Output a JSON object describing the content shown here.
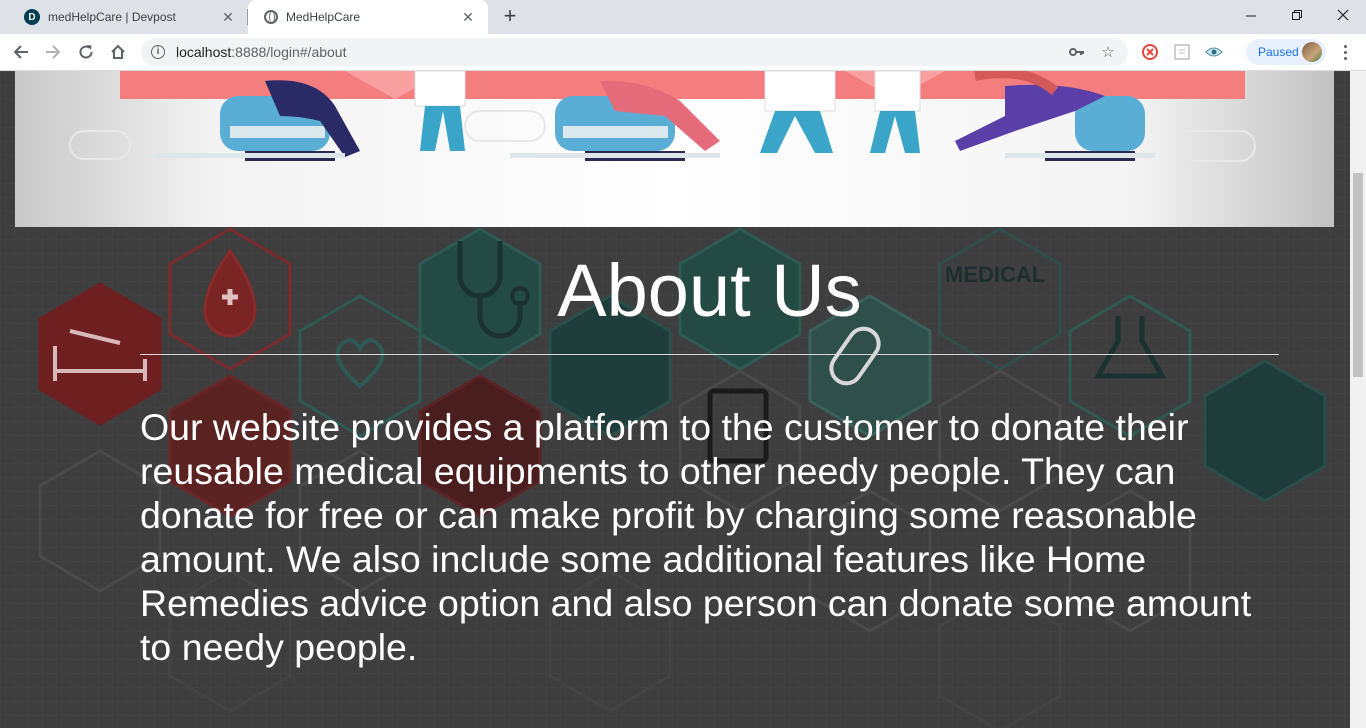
{
  "browser": {
    "tabs": [
      {
        "title": "medHelpCare | Devpost",
        "favicon": "devpost-d-icon",
        "active": false
      },
      {
        "title": "MedHelpCare",
        "favicon": "globe-icon",
        "active": true
      }
    ],
    "url_host": "localhost",
    "url_rest": ":8888/login#/about",
    "profile_label": "Paused"
  },
  "page": {
    "background_icons": [
      "MEDICAL"
    ],
    "title": "About Us",
    "description": "Our website provides a platform to the customer to donate their reusable medical equipments to other needy people. They can donate for free or can make profit by charging some reasonable amount. We also include some additional features like Home Remedies advice option and also person can donate some amount to needy people."
  },
  "colors": {
    "page_background": "#3e3e3e",
    "text": "#ffffff",
    "hero_accent": "#f47d7d"
  }
}
